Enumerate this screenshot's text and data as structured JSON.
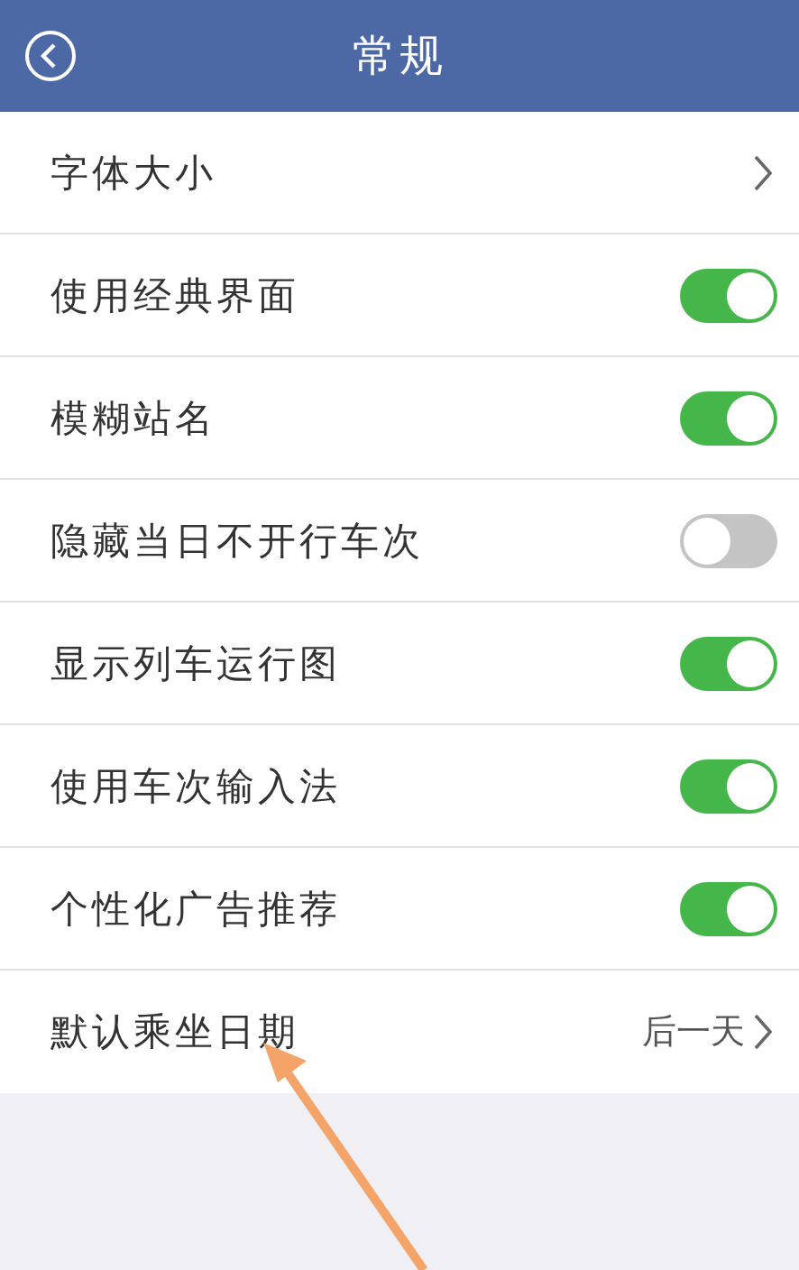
{
  "header": {
    "title": "常规"
  },
  "settings": [
    {
      "kind": "link",
      "label": "字体大小"
    },
    {
      "kind": "toggle",
      "label": "使用经典界面",
      "on": true
    },
    {
      "kind": "toggle",
      "label": "模糊站名",
      "on": true
    },
    {
      "kind": "toggle",
      "label": "隐藏当日不开行车次",
      "on": false
    },
    {
      "kind": "toggle",
      "label": "显示列车运行图",
      "on": true
    },
    {
      "kind": "toggle",
      "label": "使用车次输入法",
      "on": true
    },
    {
      "kind": "toggle",
      "label": "个性化广告推荐",
      "on": true
    },
    {
      "kind": "value",
      "label": "默认乘坐日期",
      "value": "后一天"
    }
  ]
}
